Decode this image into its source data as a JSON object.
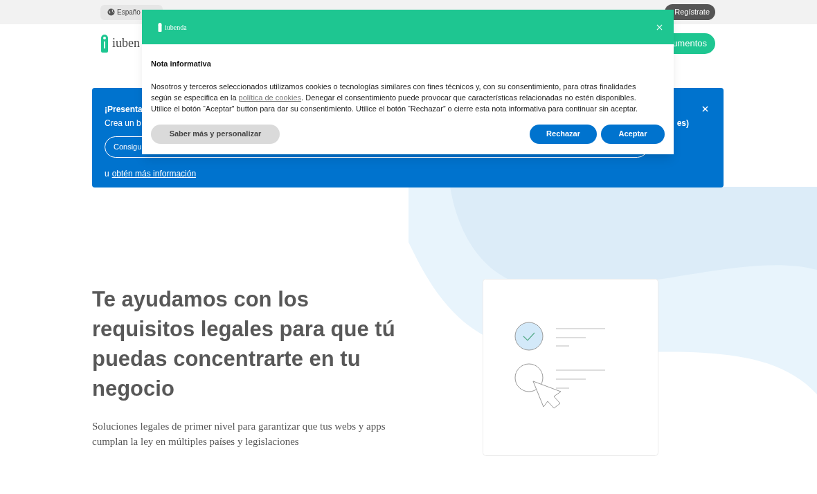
{
  "top_bar": {
    "language": "Españo",
    "register_button": "Regístrate"
  },
  "header": {
    "logo": "iuben",
    "cta_button": "umentos"
  },
  "banner": {
    "title": "¡Presenta",
    "line_start": "Crea un b",
    "line_end": "es)",
    "pill_button": "Consigu",
    "prefix": "u",
    "link": "obtén más información"
  },
  "hero": {
    "heading": "Te ayudamos con los requisitos legales para que tú puedas concentrarte en tu negocio",
    "subtitle": "Soluciones legales de primer nivel para garantizar que tus webs y apps cumplan la ley en múltiples países y legislaciones"
  },
  "cookie_dialog": {
    "logo": "iubenda",
    "title": "Nota informativa",
    "body_before": "Nosotros y terceros seleccionados utilizamos cookies o tecnologías similares con fines técnicos y, con su consentimiento, para otras finalidades según se especifica en la",
    "link": "política de cookies",
    "body_after": ". Denegar el consentimiento puede provocar que características relacionadas no estén disponibles. Utilice el botón “Aceptar” button para dar su consentimiento. Utilice el botón “Rechazar” o cierre esta nota informativa para continuar sin aceptar.",
    "buttons": [
      {
        "label": "Saber más y personalizar",
        "kind": "secondary"
      },
      {
        "label": "Rechazar",
        "kind": "primary"
      },
      {
        "label": "Aceptar",
        "kind": "primary"
      }
    ]
  }
}
